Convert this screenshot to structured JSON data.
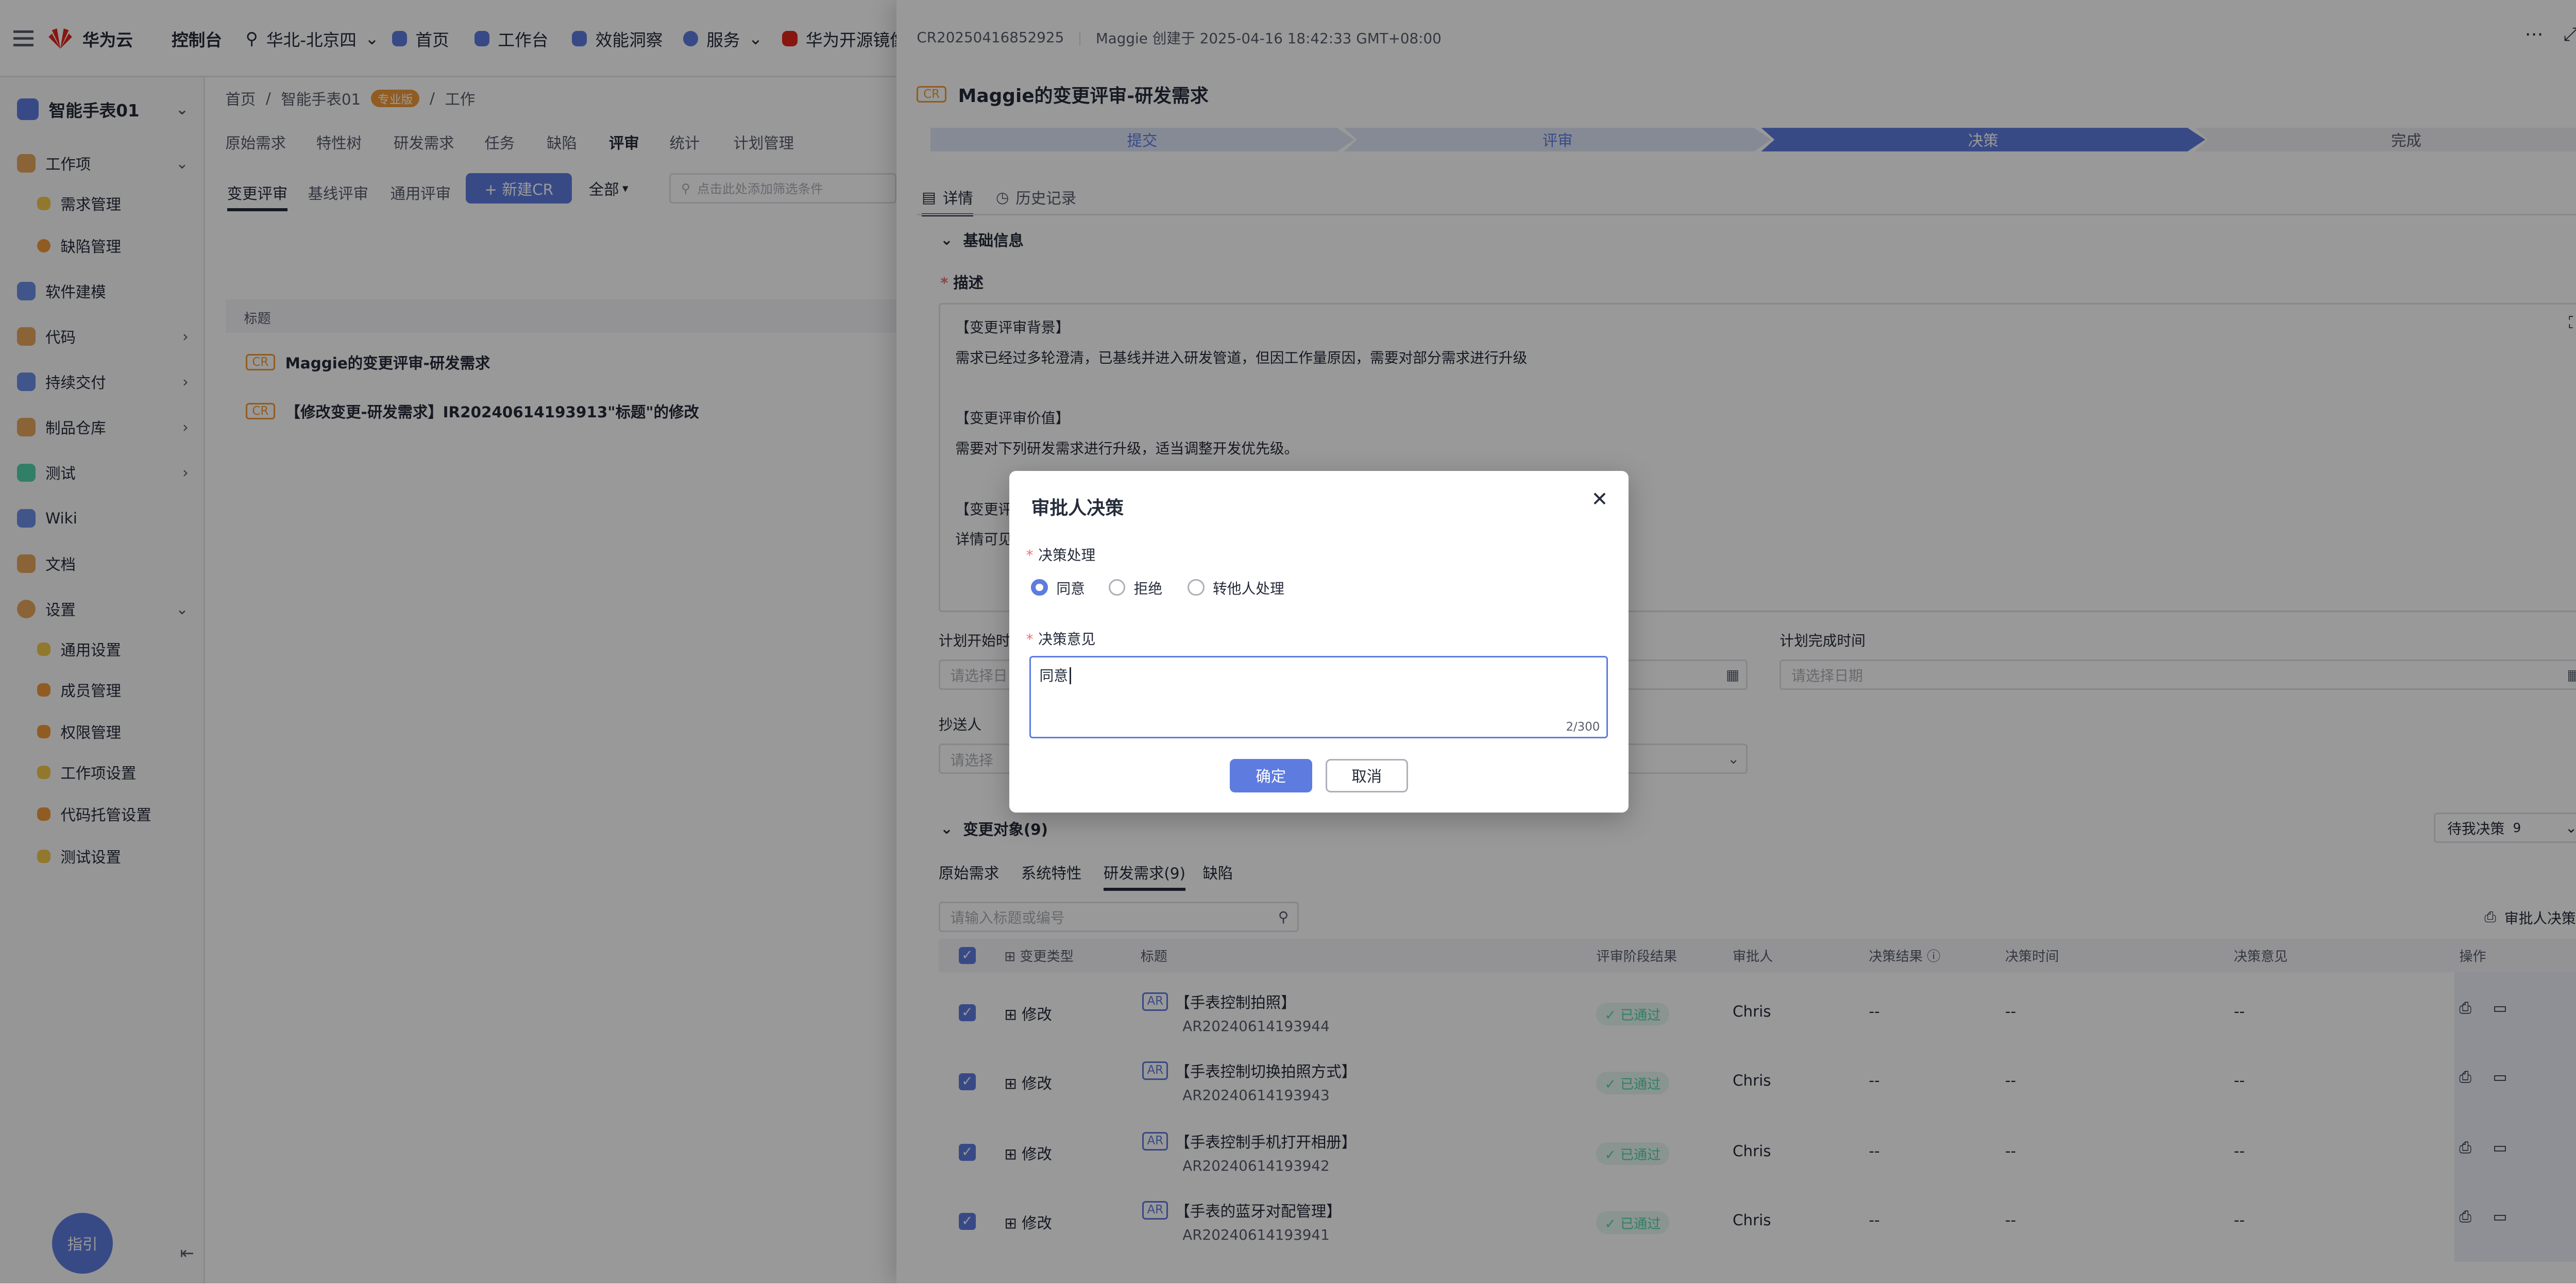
{
  "topbar": {
    "brand": "华为云",
    "console": "控制台",
    "region": "华北-北京四",
    "nav": [
      "首页",
      "工作台",
      "效能洞察",
      "服务",
      "华为开源镜像站"
    ]
  },
  "sidebar": {
    "project": "智能手表01",
    "items": [
      {
        "label": "工作项",
        "expand": "⌄"
      },
      {
        "label": "需求管理"
      },
      {
        "label": "缺陷管理"
      },
      {
        "label": "软件建模"
      },
      {
        "label": "代码",
        "expand": "›"
      },
      {
        "label": "持续交付",
        "expand": "›"
      },
      {
        "label": "制品仓库",
        "expand": "›"
      },
      {
        "label": "测试",
        "expand": "›"
      },
      {
        "label": "Wiki"
      },
      {
        "label": "文档"
      },
      {
        "label": "设置",
        "expand": "⌄"
      },
      {
        "label": "通用设置"
      },
      {
        "label": "成员管理"
      },
      {
        "label": "权限管理"
      },
      {
        "label": "工作项设置"
      },
      {
        "label": "代码托管设置"
      },
      {
        "label": "测试设置"
      }
    ],
    "guide": "指引"
  },
  "content": {
    "breadcrumb": [
      "首页",
      "智能手表01",
      "专业版",
      "工作"
    ],
    "tabs": [
      "原始需求",
      "特性树",
      "研发需求",
      "任务",
      "缺陷",
      "评审",
      "统计",
      "计划管理"
    ],
    "subtabs": [
      "变更评审",
      "基线评审",
      "通用评审"
    ],
    "new_cr": "+ 新建CR",
    "filter_all": "全部",
    "search_placeholder": "点击此处添加筛选条件",
    "col_title": "标题",
    "rows": [
      {
        "tag": "CR",
        "title": "Maggie的变更评审-研发需求"
      },
      {
        "tag": "CR",
        "title": "【修改变更-研发需求】IR20240614193913\"标题\"的修改"
      }
    ]
  },
  "drawer": {
    "cr_id": "CR20250416852925",
    "creator": "Maggie 创建于 2025-04-16 18:42:33 GMT+08:00",
    "cr_tag": "CR",
    "title": "Maggie的变更评审-研发需求",
    "steps": [
      "提交",
      "评审",
      "决策",
      "完成"
    ],
    "tabs": [
      "详情",
      "历史记录"
    ],
    "section_basic": "基础信息",
    "desc_label": "描述",
    "desc_lines": [
      "【变更评审背景】",
      "需求已经过多轮澄清，已基线并进入研发管道，但因工作量原因，需要对部分需求进行升级",
      "【变更评审价值】",
      "需要对下列研发需求进行升级，适当调整开发优先级。",
      "【变更评",
      "详情可见"
    ],
    "plan_start_label": "计划开始时",
    "plan_start_ph": "请选择日",
    "plan_end_label": "计划完成时间",
    "plan_end_ph": "请选择日期",
    "cc_label": "抄送人",
    "cc_ph": "请选择",
    "section_objects": "变更对象(9)",
    "pending_filter": "待我决策",
    "pending_count": "9",
    "obj_tabs": [
      "原始需求",
      "系统特性",
      "研发需求(9)",
      "缺陷"
    ],
    "obj_search_ph": "请输入标题或编号",
    "approver_decision_btn": "审批人决策",
    "columns": [
      "变更类型",
      "标题",
      "评审阶段结果",
      "审批人",
      "决策结果",
      "决策时间",
      "决策意见",
      "操作"
    ],
    "rows": [
      {
        "type": "修改",
        "title": "【手表控制拍照】",
        "code": "AR20240614193944",
        "result": "已通过",
        "approver": "Chris",
        "decision": "--",
        "time": "--",
        "opinion": "--"
      },
      {
        "type": "修改",
        "title": "【手表控制切换拍照方式】",
        "code": "AR20240614193943",
        "result": "已通过",
        "approver": "Chris",
        "decision": "--",
        "time": "--",
        "opinion": "--"
      },
      {
        "type": "修改",
        "title": "【手表控制手机打开相册】",
        "code": "AR20240614193942",
        "result": "已通过",
        "approver": "Chris",
        "decision": "--",
        "time": "--",
        "opinion": "--"
      },
      {
        "type": "修改",
        "title": "【手表的蓝牙对配管理】",
        "code": "AR20240614193941",
        "result": "已通过",
        "approver": "Chris",
        "decision": "--",
        "time": "--",
        "opinion": "--"
      }
    ]
  },
  "modal": {
    "title": "审批人决策",
    "decision_label": "决策处理",
    "options": [
      "同意",
      "拒绝",
      "转他人处理"
    ],
    "opinion_label": "决策意见",
    "opinion_value": "同意",
    "counter": "2/300",
    "confirm": "确定",
    "cancel": "取消"
  },
  "colors": {
    "accent": "#5e7ce0",
    "success": "#50d4ab",
    "danger": "#f66f6a"
  }
}
